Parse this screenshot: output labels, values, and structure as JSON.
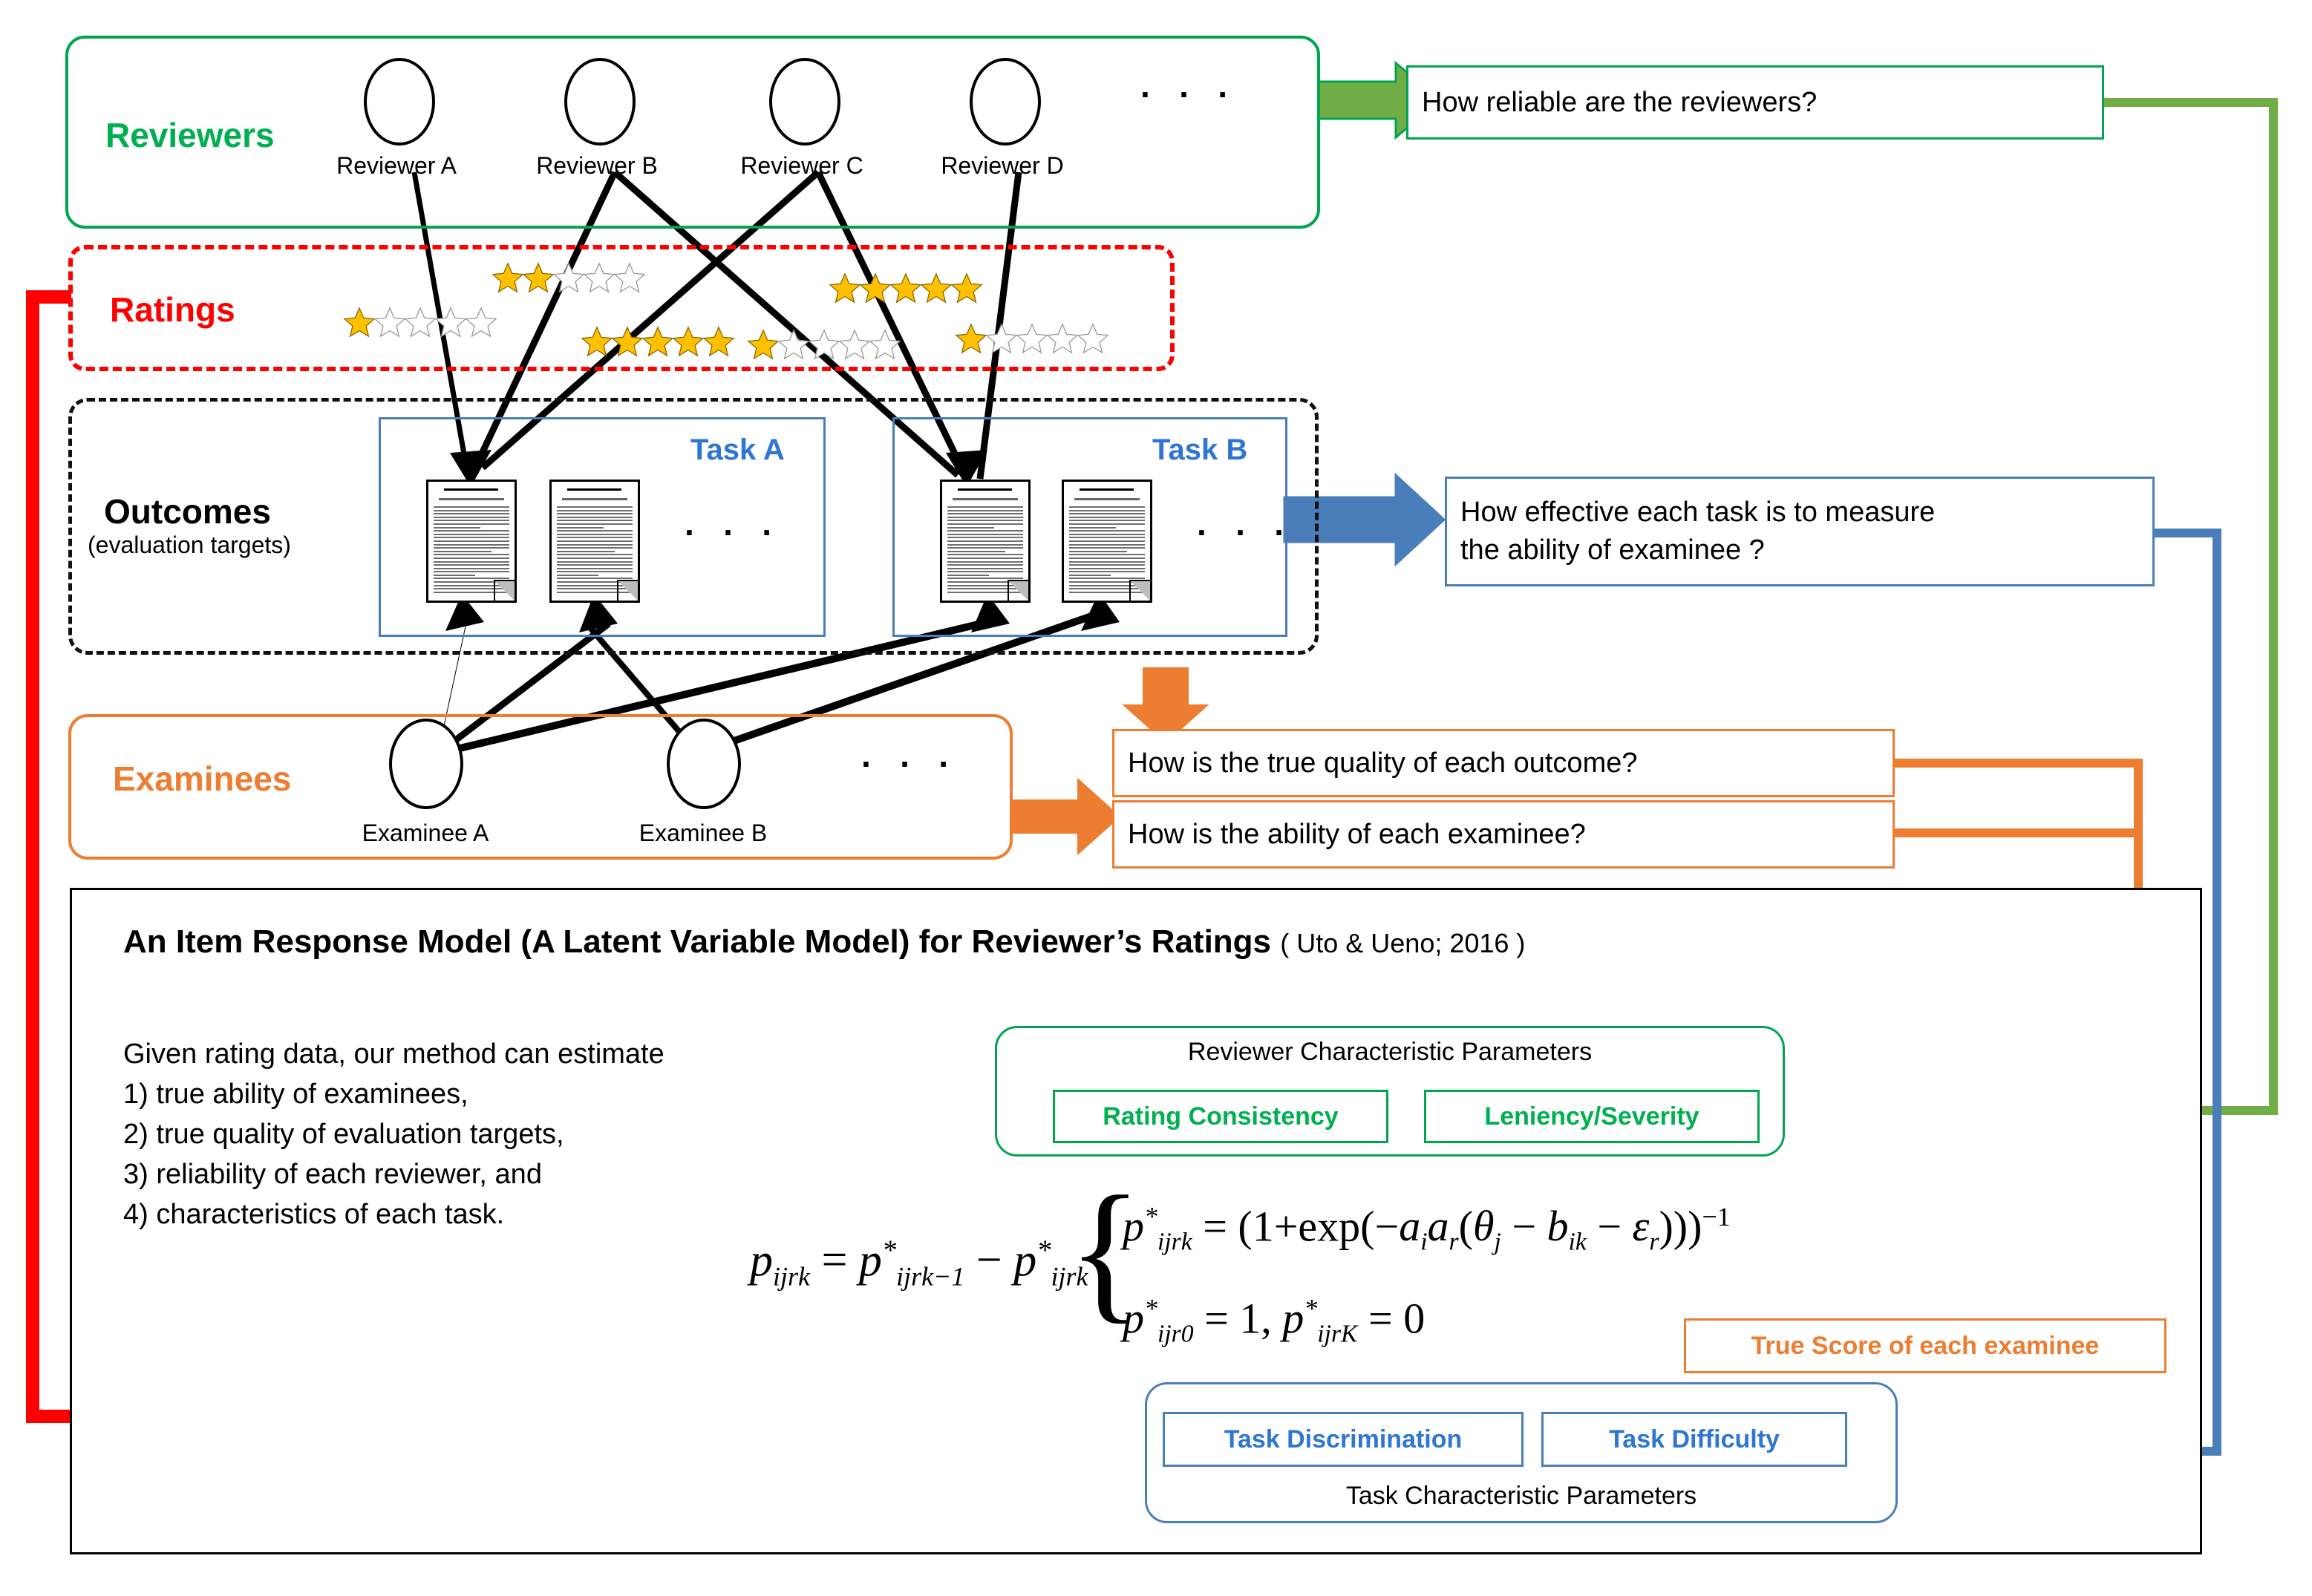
{
  "groups": {
    "reviewers": {
      "label": "Reviewers"
    },
    "ratings": {
      "label": "Ratings"
    },
    "outcomes": {
      "label": "Outcomes",
      "sublabel": "(evaluation targets)"
    },
    "examinees": {
      "label": "Examinees"
    }
  },
  "reviewers": {
    "people": [
      {
        "label": "Reviewer A"
      },
      {
        "label": "Reviewer B"
      },
      {
        "label": "Reviewer C"
      },
      {
        "label": "Reviewer D"
      }
    ],
    "ellipsis": "· · ·"
  },
  "examinees": {
    "people": [
      {
        "label": "Examinee A"
      },
      {
        "label": "Examinee B"
      }
    ],
    "ellipsis": "· · ·"
  },
  "ratings": {
    "max_stars": 5,
    "items": [
      {
        "id": "rating-1",
        "filled": 1
      },
      {
        "id": "rating-2",
        "filled": 2
      },
      {
        "id": "rating-3",
        "filled": 5
      },
      {
        "id": "rating-4",
        "filled": 5
      },
      {
        "id": "rating-5",
        "filled": 1
      },
      {
        "id": "rating-6",
        "filled": 1
      }
    ],
    "star_filled_color": "#FFC000",
    "star_empty_color": "#FFFFFF"
  },
  "outcomes": {
    "tasks": [
      {
        "title": "Task A",
        "papers": 2,
        "ellipsis": "· · ·"
      },
      {
        "title": "Task B",
        "papers": 2,
        "ellipsis": "· · ·"
      }
    ]
  },
  "questions": [
    {
      "id": "q-reviewers",
      "text": "How reliable are the reviewers?",
      "color": "#00A550"
    },
    {
      "id": "q-task",
      "text": "How effective each task is to measure\nthe ability of examinee ?",
      "color": "#4A7EBB"
    },
    {
      "id": "q-quality",
      "text": "How is the true quality of each outcome?",
      "color": "#ED7D31"
    },
    {
      "id": "q-ability",
      "text": "How is the ability of each examinee?",
      "color": "#ED7D31"
    }
  ],
  "model": {
    "title": "An Item Response Model (A Latent Variable Model) for Reviewer’s Ratings",
    "citation": "( Uto & Ueno; 2016 )",
    "body": "Given rating data, our method can estimate\n1) true ability of examinees,\n2) true quality of evaluation targets,\n3) reliability of each reviewer, and\n4) characteristics of each task."
  },
  "parameters": {
    "reviewer_group_caption": "Reviewer Characteristic Parameters",
    "reviewer_params": [
      "Rating Consistency",
      "Leniency/Severity"
    ],
    "task_group_caption": "Task Characteristic Parameters",
    "task_params": [
      "Task Discrimination",
      "Task Difficulty"
    ],
    "examinee_param": "True Score of each examinee"
  },
  "colors": {
    "green": "#00A550",
    "green_arrow": "#70AD47",
    "blue": "#4A7EBB",
    "orange": "#ED7D31",
    "red": "#FF0000",
    "star": "#FFC000"
  }
}
